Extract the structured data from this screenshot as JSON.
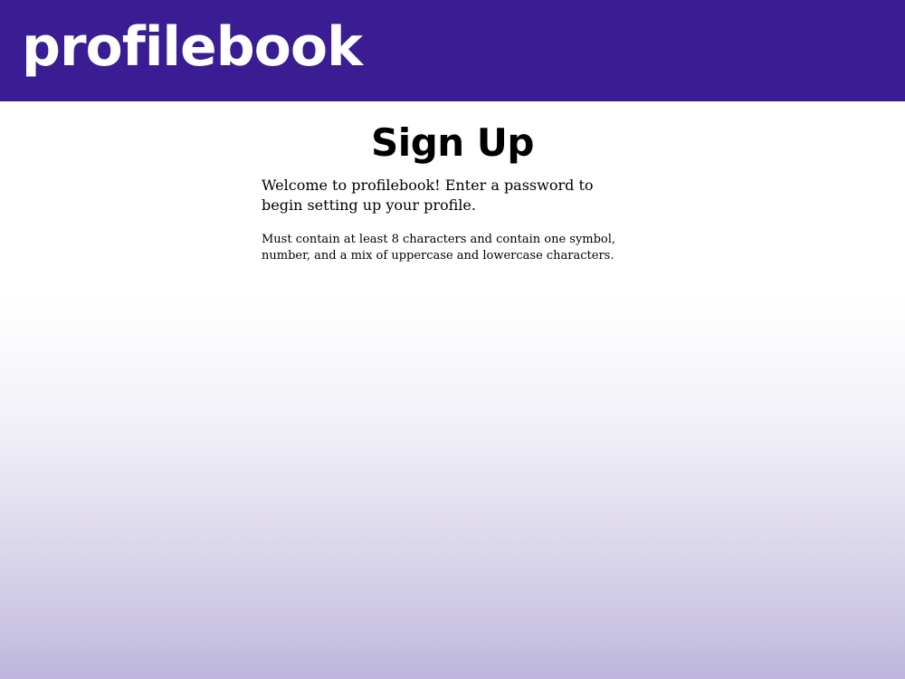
{
  "header": {
    "logo_text": "profilebook"
  },
  "main": {
    "title": "Sign Up",
    "welcome_text": "Welcome to profilebook! Enter a password to begin setting up your profile.",
    "password_requirements": "Must contain at least 8 characters and contain one symbol, number, and a mix of uppercase and lowercase characters."
  },
  "colors": {
    "header_background": "#3a1c93",
    "logo_text": "#ffffff",
    "gradient_bottom": "#bdb5dc"
  }
}
